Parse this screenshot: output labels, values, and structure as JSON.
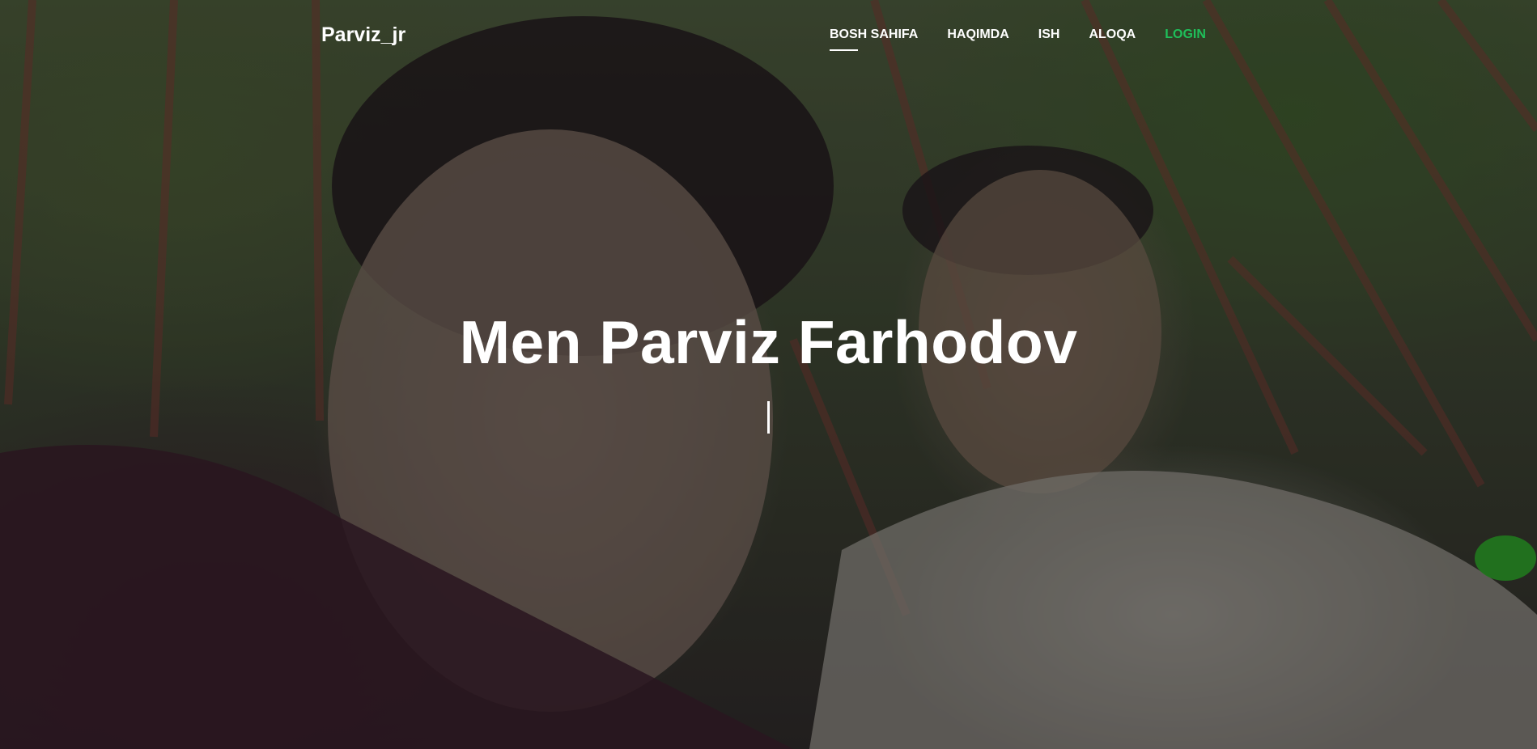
{
  "brand": "Parviz_jr",
  "nav": {
    "items": [
      {
        "label": "BOSH SAHIFA"
      },
      {
        "label": "HAQIMDA"
      },
      {
        "label": "ISH"
      },
      {
        "label": "ALOQA"
      },
      {
        "label": "LOGIN"
      }
    ]
  },
  "hero": {
    "title": "Men Parviz Farhodov",
    "typed_text": ""
  },
  "colors": {
    "accent_login": "#1fbf5a",
    "text": "#ffffff"
  }
}
